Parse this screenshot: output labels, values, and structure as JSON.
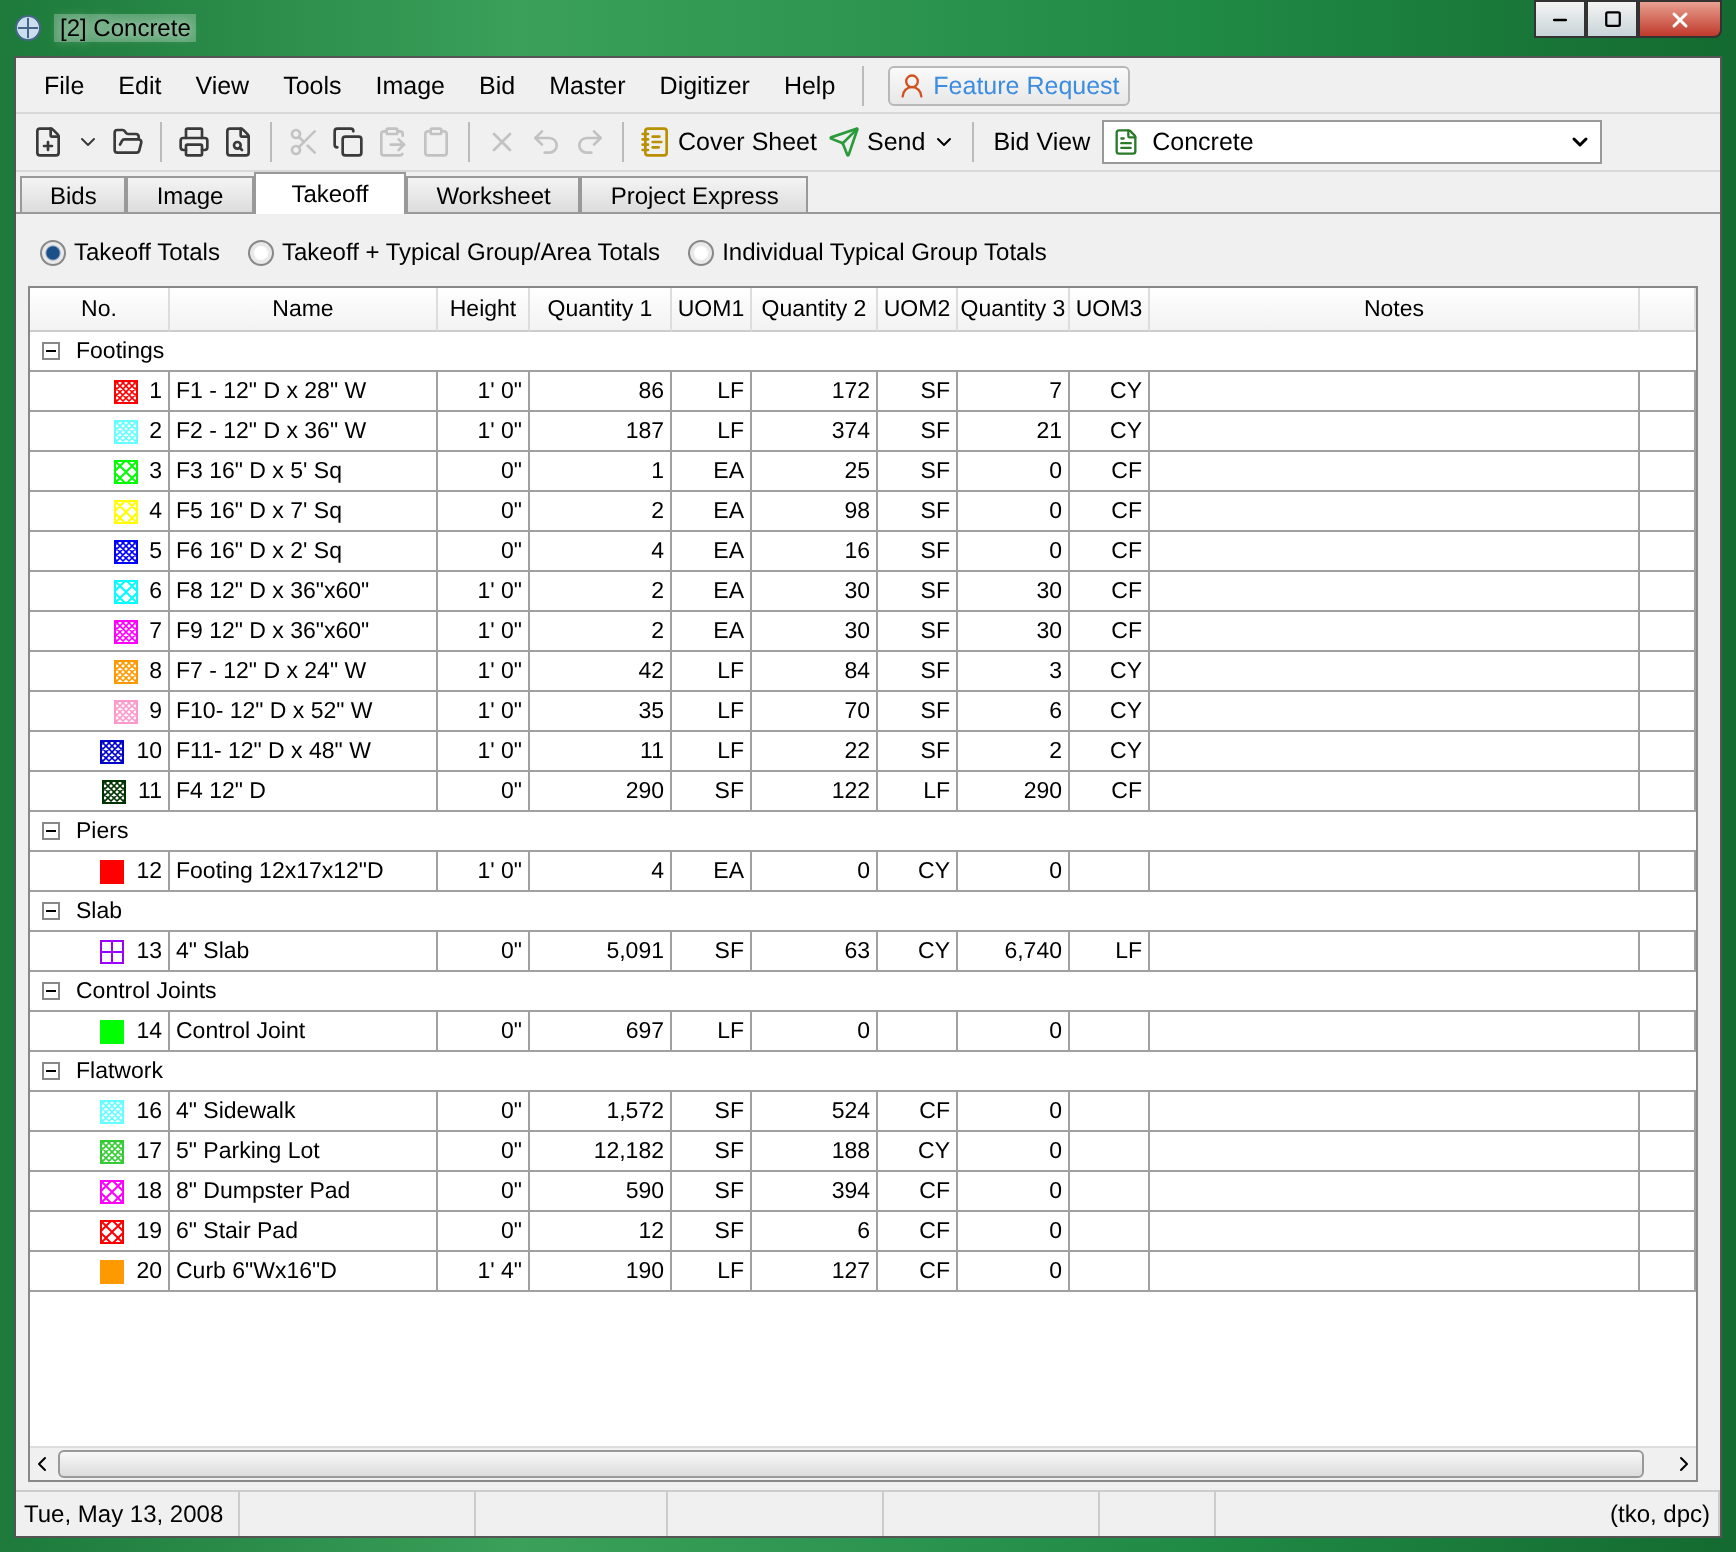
{
  "window": {
    "title": "[2] Concrete"
  },
  "menu": [
    "File",
    "Edit",
    "View",
    "Tools",
    "Image",
    "Bid",
    "Master",
    "Digitizer",
    "Help"
  ],
  "feature_request": "Feature Request",
  "toolbar": [
    {
      "kind": "new",
      "disabled": false
    },
    {
      "kind": "dropdown",
      "disabled": false
    },
    {
      "kind": "open",
      "disabled": false
    },
    {
      "kind": "separator"
    },
    {
      "kind": "print",
      "disabled": false
    },
    {
      "kind": "preview",
      "disabled": false
    },
    {
      "kind": "separator"
    },
    {
      "kind": "cut",
      "disabled": true
    },
    {
      "kind": "copy",
      "disabled": false
    },
    {
      "kind": "paste",
      "disabled": true
    },
    {
      "kind": "pastespecial",
      "disabled": true
    },
    {
      "kind": "separator"
    },
    {
      "kind": "delete",
      "disabled": true
    },
    {
      "kind": "undo",
      "disabled": true
    },
    {
      "kind": "redo",
      "disabled": true
    },
    {
      "kind": "separator"
    }
  ],
  "cover_sheet": "Cover Sheet",
  "send": "Send",
  "bid_view": {
    "label": "Bid View",
    "value": "Concrete"
  },
  "tabs": [
    {
      "label": "Bids",
      "selected": false
    },
    {
      "label": "Image",
      "selected": false
    },
    {
      "label": "Takeoff",
      "selected": true
    },
    {
      "label": "Worksheet",
      "selected": false
    },
    {
      "label": "Project Express",
      "selected": false
    }
  ],
  "totals_options": [
    {
      "label": "Takeoff Totals",
      "selected": true
    },
    {
      "label": "Takeoff + Typical Group/Area Totals",
      "selected": false
    },
    {
      "label": "Individual Typical Group Totals",
      "selected": false
    }
  ],
  "table": {
    "columns": [
      "No.",
      "Name",
      "Height",
      "Quantity 1",
      "UOM1",
      "Quantity 2",
      "UOM2",
      "Quantity 3",
      "UOM3",
      "Notes"
    ],
    "groups": [
      {
        "name": "Footings",
        "expanded": true,
        "rows": [
          {
            "no": "1",
            "name": "F1 - 12\" D x 28\" W",
            "height": "1' 0\"",
            "q1": "86",
            "u1": "LF",
            "q2": "172",
            "u2": "SF",
            "q3": "7",
            "u3": "CY",
            "color": "#ff0000",
            "kind": "hatch"
          },
          {
            "no": "2",
            "name": "F2 - 12\" D x 36\" W",
            "height": "1' 0\"",
            "q1": "187",
            "u1": "LF",
            "q2": "374",
            "u2": "SF",
            "q3": "21",
            "u3": "CY",
            "color": "#66ffff",
            "kind": "hatch"
          },
          {
            "no": "3",
            "name": "F3 16\" D x 5' Sq",
            "height": "0\"",
            "q1": "1",
            "u1": "EA",
            "q2": "25",
            "u2": "SF",
            "q3": "0",
            "u3": "CF",
            "color": "#00ff00",
            "kind": "cross"
          },
          {
            "no": "4",
            "name": "F5 16\" D x 7' Sq",
            "height": "0\"",
            "q1": "2",
            "u1": "EA",
            "q2": "98",
            "u2": "SF",
            "q3": "0",
            "u3": "CF",
            "color": "#ffff00",
            "kind": "cross"
          },
          {
            "no": "5",
            "name": "F6 16\" D x 2' Sq",
            "height": "0\"",
            "q1": "4",
            "u1": "EA",
            "q2": "16",
            "u2": "SF",
            "q3": "0",
            "u3": "CF",
            "color": "#0000ff",
            "kind": "hatch"
          },
          {
            "no": "6",
            "name": "F8 12\" D x 36\"x60\"",
            "height": "1' 0\"",
            "q1": "2",
            "u1": "EA",
            "q2": "30",
            "u2": "SF",
            "q3": "30",
            "u3": "CF",
            "color": "#00ffff",
            "kind": "cross"
          },
          {
            "no": "7",
            "name": "F9 12\" D x 36\"x60\"",
            "height": "1' 0\"",
            "q1": "2",
            "u1": "EA",
            "q2": "30",
            "u2": "SF",
            "q3": "30",
            "u3": "CF",
            "color": "#ff00ff",
            "kind": "hatch"
          },
          {
            "no": "8",
            "name": "F7 - 12\" D x 24\" W",
            "height": "1' 0\"",
            "q1": "42",
            "u1": "LF",
            "q2": "84",
            "u2": "SF",
            "q3": "3",
            "u3": "CY",
            "color": "#ff9900",
            "kind": "hatch"
          },
          {
            "no": "9",
            "name": "F10- 12\" D x 52\" W",
            "height": "1' 0\"",
            "q1": "35",
            "u1": "LF",
            "q2": "70",
            "u2": "SF",
            "q3": "6",
            "u3": "CY",
            "color": "#ff99cc",
            "kind": "hatch"
          },
          {
            "no": "10",
            "name": "F11- 12\" D x 48\" W",
            "height": "1' 0\"",
            "q1": "11",
            "u1": "LF",
            "q2": "22",
            "u2": "SF",
            "q3": "2",
            "u3": "CY",
            "color": "#0000cc",
            "kind": "hatch"
          },
          {
            "no": "11",
            "name": "F4 12\" D",
            "height": "0\"",
            "q1": "290",
            "u1": "SF",
            "q2": "122",
            "u2": "LF",
            "q3": "290",
            "u3": "CF",
            "color": "#003300",
            "kind": "hatch"
          }
        ]
      },
      {
        "name": "Piers",
        "expanded": true,
        "rows": [
          {
            "no": "12",
            "name": "Footing 12x17x12\"D",
            "height": "1' 0\"",
            "q1": "4",
            "u1": "EA",
            "q2": "0",
            "u2": "CY",
            "q3": "0",
            "u3": "",
            "color": "#ff0000",
            "kind": "solid"
          }
        ]
      },
      {
        "name": "Slab",
        "expanded": true,
        "rows": [
          {
            "no": "13",
            "name": "4\" Slab",
            "height": "0\"",
            "q1": "5,091",
            "u1": "SF",
            "q2": "63",
            "u2": "CY",
            "q3": "6,740",
            "u3": "LF",
            "color": "#9900ff",
            "kind": "grid"
          }
        ]
      },
      {
        "name": "Control Joints",
        "expanded": true,
        "rows": [
          {
            "no": "14",
            "name": "Control Joint",
            "height": "0\"",
            "q1": "697",
            "u1": "LF",
            "q2": "0",
            "u2": "",
            "q3": "0",
            "u3": "",
            "color": "#00ff00",
            "kind": "solid"
          }
        ]
      },
      {
        "name": "Flatwork",
        "expanded": true,
        "rows": [
          {
            "no": "16",
            "name": "4\" Sidewalk",
            "height": "0\"",
            "q1": "1,572",
            "u1": "SF",
            "q2": "524",
            "u2": "CF",
            "q3": "0",
            "u3": "",
            "color": "#66ffff",
            "kind": "hatch"
          },
          {
            "no": "17",
            "name": "5\" Parking Lot",
            "height": "0\"",
            "q1": "12,182",
            "u1": "SF",
            "q2": "188",
            "u2": "CY",
            "q3": "0",
            "u3": "",
            "color": "#33cc33",
            "kind": "hatch"
          },
          {
            "no": "18",
            "name": "8\" Dumpster Pad",
            "height": "0\"",
            "q1": "590",
            "u1": "SF",
            "q2": "394",
            "u2": "CF",
            "q3": "0",
            "u3": "",
            "color": "#ff00ff",
            "kind": "cross"
          },
          {
            "no": "19",
            "name": "6\" Stair Pad",
            "height": "0\"",
            "q1": "12",
            "u1": "SF",
            "q2": "6",
            "u2": "CF",
            "q3": "0",
            "u3": "",
            "color": "#ff0000",
            "kind": "cross"
          },
          {
            "no": "20",
            "name": "Curb 6\"Wx16\"D",
            "height": "1' 4\"",
            "q1": "190",
            "u1": "LF",
            "q2": "127",
            "u2": "CF",
            "q3": "0",
            "u3": "",
            "color": "#ff9900",
            "kind": "solid"
          }
        ]
      }
    ]
  },
  "status_bar": {
    "date": "Tue, May 13, 2008",
    "user": "(tko, dpc)"
  }
}
